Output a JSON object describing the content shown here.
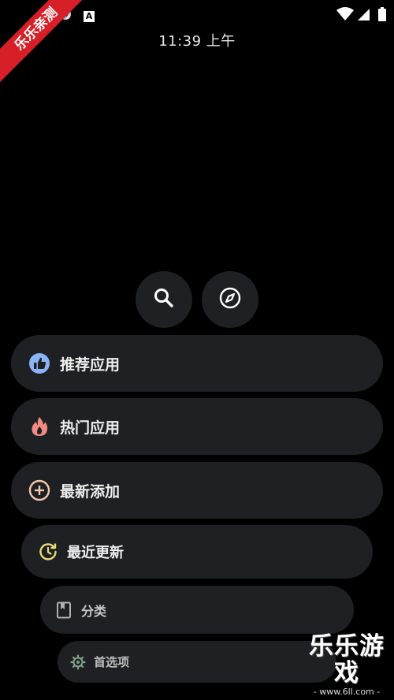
{
  "status_bar": {
    "time": "11:39 上午",
    "a_indicator": "A"
  },
  "badge": {
    "text": "乐乐亲测"
  },
  "top_buttons": [
    {
      "icon": "search-icon"
    },
    {
      "icon": "compass-icon"
    }
  ],
  "menu": [
    {
      "icon": "thumbs-up-icon",
      "label": "推荐应用",
      "icon_color": "#8ab4f8"
    },
    {
      "icon": "fire-icon",
      "label": "热门应用",
      "icon_color": "#f28b82"
    },
    {
      "icon": "plus-circle-icon",
      "label": "最新添加",
      "icon_color": "#f0c8b0"
    },
    {
      "icon": "refresh-clock-icon",
      "label": "最近更新",
      "icon_color": "#e6db74"
    },
    {
      "icon": "book-icon",
      "label": "分类",
      "icon_color": "#b0b0b0"
    },
    {
      "icon": "gear-icon",
      "label": "首选项",
      "icon_color": "#7fa08a"
    }
  ],
  "watermark": {
    "logo": "乐乐游戏",
    "url": "- www.6ll.com -"
  }
}
